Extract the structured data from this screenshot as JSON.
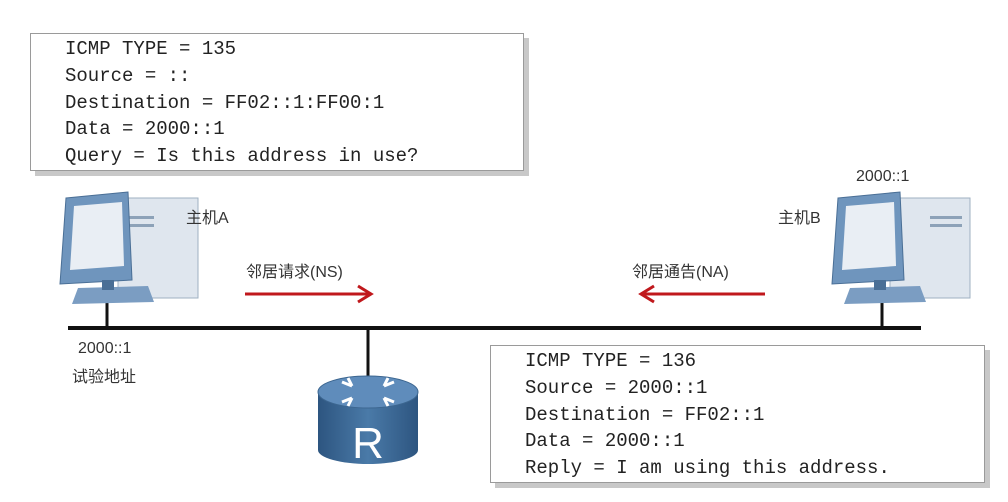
{
  "ns_packet": {
    "lines": [
      "ICMP TYPE = 135",
      "Source = ::",
      "Destination = FF02::1:FF00:1",
      "Data = 2000::1",
      "Query = Is this address in use?"
    ]
  },
  "na_packet": {
    "lines": [
      "ICMP TYPE = 136",
      "Source = 2000::1",
      "Destination = FF02::1",
      "Data = 2000::1",
      "Reply = I am using this address."
    ]
  },
  "host_a": {
    "name": "主机A",
    "address": "2000::1",
    "note": "试验地址"
  },
  "host_b": {
    "name": "主机B",
    "address": "2000::1"
  },
  "router": {
    "label": "R"
  },
  "arrows": {
    "ns_label": "邻居请求(NS)",
    "na_label": "邻居通告(NA)",
    "color": "#c0181c"
  }
}
